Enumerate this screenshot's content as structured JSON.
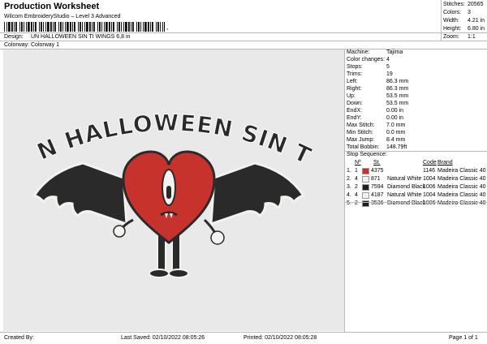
{
  "header": {
    "title": "Production Worksheet",
    "subtitle": "Wilcom EmbroideryStudio – Level 3 Advanced",
    "barcode_tail": ","
  },
  "design_info": {
    "design_label": "Design:",
    "design_value": "UN HALLOWEEN SIN TI WINGS 6,8 in",
    "colorway_label": "Colorway:",
    "colorway_value": "Colorway 1"
  },
  "summary": [
    {
      "label": "Stitches:",
      "value": "20565"
    },
    {
      "label": "Colors:",
      "value": "3"
    },
    {
      "label": "Width:",
      "value": "4.21 in"
    },
    {
      "label": "Height:",
      "value": "6.80 in"
    },
    {
      "label": "Zoom:",
      "value": "1:1"
    }
  ],
  "machine_info": [
    {
      "label": "Machine:",
      "value": "Tajima"
    },
    {
      "label": "Color changes:",
      "value": "4"
    },
    {
      "label": "Stops:",
      "value": "5"
    },
    {
      "label": "Trims:",
      "value": "19"
    },
    {
      "label": "Left:",
      "value": "86.3 mm"
    },
    {
      "label": "Right:",
      "value": "86.3 mm"
    },
    {
      "label": "Up:",
      "value": "53.5 mm"
    },
    {
      "label": "Down:",
      "value": "53.5 mm"
    },
    {
      "label": "EndX:",
      "value": "0.00 in"
    },
    {
      "label": "EndY:",
      "value": "0.00 in"
    },
    {
      "label": "Max Stitch:",
      "value": "7.0 mm"
    },
    {
      "label": "Min Stitch:",
      "value": "0.0 mm"
    },
    {
      "label": "Max Jump:",
      "value": "8.4 mm"
    },
    {
      "label": "Total Bobbin:",
      "value": "148.79ft"
    }
  ],
  "stop_sequence": {
    "title": "Stop Sequence:",
    "columns": [
      "Nº",
      "St.",
      "Code",
      "Brand"
    ],
    "rows": [
      {
        "stop": "1.",
        "n": "1",
        "color": "#c8322d",
        "code_num": "4375",
        "name": "",
        "stitches": "1146",
        "brand": "Madeira Classic 40"
      },
      {
        "stop": "2.",
        "n": "4",
        "color": "#f4f2ee",
        "code_num": "871",
        "name": "Natural White",
        "stitches": "1004",
        "brand": "Madeira Classic 40"
      },
      {
        "stop": "3.",
        "n": "2",
        "color": "#1e1e1e",
        "code_num": "7594",
        "name": "Diamond Black",
        "stitches": "1006",
        "brand": "Madeira Classic 40"
      },
      {
        "stop": "4.",
        "n": "4",
        "color": "#f4f2ee",
        "code_num": "4187",
        "name": "Natural White",
        "stitches": "1004",
        "brand": "Madeira Classic 40"
      },
      {
        "stop": "5.",
        "n": "2",
        "color": "#1e1e1e",
        "code_num": "3536",
        "name": "Diamond Black",
        "stitches": "1006",
        "brand": "Madeira Classic 40"
      }
    ]
  },
  "design_art": {
    "arc_text": "UN HALLOWEEN SIN TI",
    "colors": {
      "heart": "#c8322d",
      "black": "#2a2a2a",
      "white": "#f4f2ee",
      "canvas": "#e9e9e9"
    }
  },
  "footer": {
    "created_by": "Created By:",
    "last_saved": "Last Saved: 02/10/2022 08:05:26",
    "printed": "Printed: 02/10/2022 08:05:28",
    "page": "Page 1 of 1"
  }
}
